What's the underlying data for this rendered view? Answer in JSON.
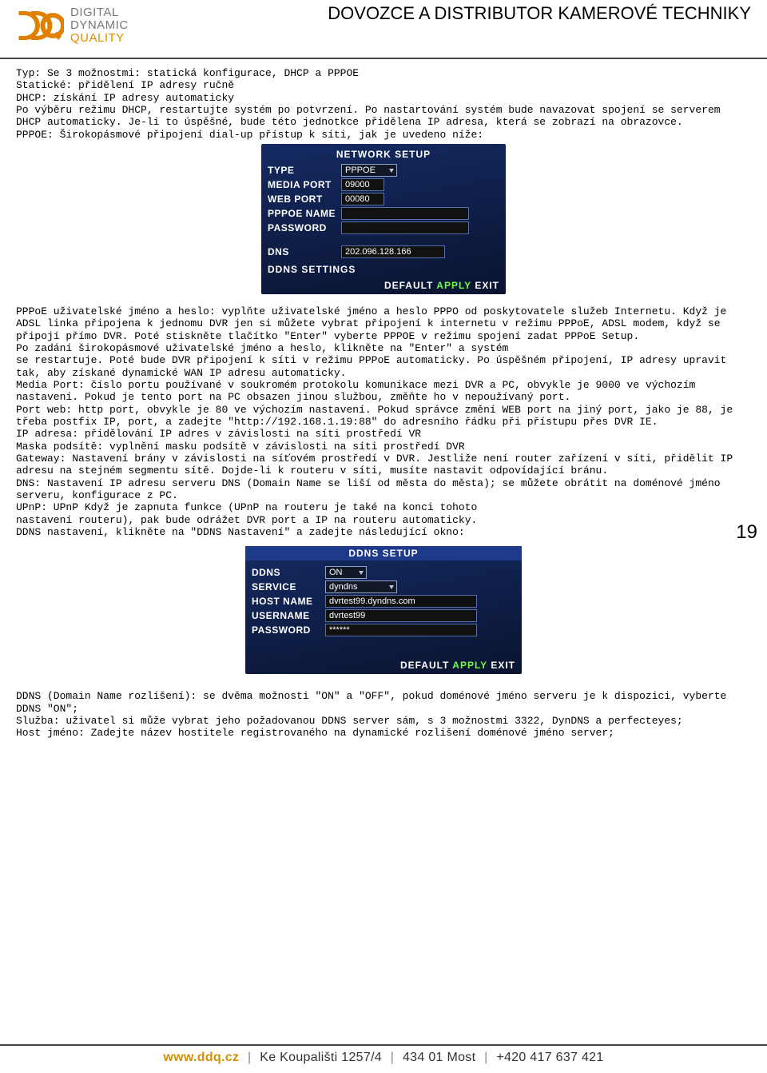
{
  "header": {
    "brand_line1": "DIGITAL",
    "brand_line2": "DYNAMIC",
    "brand_line3": "QUALITY",
    "tagline": "DOVOZCE A DISTRIBUTOR KAMEROVÉ TECHNIKY"
  },
  "text_block_1": "Typ: Se 3 možnostmi: statická konfigurace, DHCP a PPPOE\nStatické: přidělení IP adresy ručně\nDHCP: získání IP adresy automaticky\nPo výběru režimu DHCP, restartujte systém po potvrzení. Po nastartování systém bude navazovat spojení se serverem DHCP automaticky. Je-li to úspěšné, bude této jednotkce přidělena IP adresa, která se zobrazí na obrazovce.\nPPPOE: Širokopásmové připojení dial-up přístup k síti, jak je uvedeno níže:",
  "screenshot1": {
    "title": "NETWORK SETUP",
    "rows": {
      "type_label": "TYPE",
      "type_value": "PPPOE",
      "media_label": "MEDIA PORT",
      "media_value": "09000",
      "web_label": "WEB   PORT",
      "web_value": "00080",
      "pppoe_label": "PPPOE NAME",
      "pppoe_value": "",
      "pass_label": "PASSWORD",
      "pass_value": "",
      "dns_label": "DNS",
      "dns_value": "202.096.128.166"
    },
    "ddns_label": "DDNS SETTINGS",
    "buttons": {
      "default": "DEFAULT",
      "apply": "APPLY",
      "exit": "EXIT"
    }
  },
  "text_block_2": "PPPoE uživatelské jméno a heslo: vyplňte uživatelské jméno a heslo PPPO od poskytovatele služeb Internetu. Když je ADSL linka připojena k jednomu DVR jen si můžete vybrat připojení k internetu v režimu PPPoE, ADSL modem, když se připojí přímo DVR. Poté stiskněte tlačítko \"Enter\" vyberte PPPOE v režimu spojení zadat PPPoE Setup.\nPo zadání širokopásmové uživatelské jméno a heslo, klikněte na \"Enter\" a systém\nse restartuje. Poté bude DVR připojení k síti v režimu PPPoE automaticky. Po úspěšném připojení, IP adresy upravit tak, aby získané dynamické WAN IP adresu automaticky.\nMedia Port: číslo portu používané v soukromém protokolu komunikace mezi DVR a PC, obvykle je 9000 ve výchozím nastavení. Pokud je tento port na PC obsazen jinou službou, změňte ho v nepoužívaný port.\nPort web: http port, obvykle je 80 ve výchozím nastavení. Pokud správce změní WEB port na jiný port, jako je 88, je třeba postfix IP, port, a zadejte \"http://192.168.1.19:88\" do adresního řádku při přístupu přes DVR IE.\nIP adresa: přidělování IP adres v závislosti na síti prostředí VR\nMaska podsítě: vyplnění masku podsítě v závislosti na síti prostředí DVR\nGateway: Nastavení brány v závislosti na síťovém prostředí v DVR. Jestliže není router zařízení v síti, přidělit IP adresu na stejném segmentu sítě. Dojde-li k routeru v síti, musíte nastavit odpovídající bránu.\nDNS: Nastavení IP adresu serveru DNS (Domain Name se liší od města do města); se můžete obrátit na doménové jméno serveru, konfigurace z PC.\nUPnP: UPnP Když je zapnuta funkce (UPnP na routeru je také na konci tohoto\nnastavení routeru), pak bude odrážet DVR port a IP na routeru automaticky.\nDDNS nastavení, klikněte na \"DDNS Nastavení\" a zadejte následující okno:",
  "screenshot2": {
    "title": "DDNS SETUP",
    "rows": {
      "ddns_label": "DDNS",
      "ddns_value": "ON",
      "svc_label": "SERVICE",
      "svc_value": "dyndns",
      "host_label": "HOST NAME",
      "host_value": "dvrtest99.dyndns.com",
      "user_label": "USERNAME",
      "user_value": "dvrtest99",
      "pass_label": "PASSWORD",
      "pass_value": "******"
    },
    "buttons": {
      "default": "DEFAULT",
      "apply": "APPLY",
      "exit": "EXIT"
    }
  },
  "text_block_3": "DDNS (Domain Name rozlišení): se dvěma možnosti \"ON\" a \"OFF\", pokud doménové jméno serveru je k dispozici, vyberte DDNS \"ON\";\nSlužba: uživatel si může vybrat jeho požadovanou DDNS server sám, s 3 možnostmi 3322, DynDNS a perfecteyes;\nHost jméno: Zadejte název hostitele registrovaného na dynamické rozlišení doménové jméno server;",
  "page_number": "19",
  "footer": {
    "url": "www.ddq.cz",
    "addr1": "Ke Koupališti 1257/4",
    "addr2": "434 01 Most",
    "phone": "+420 417 637 421"
  }
}
